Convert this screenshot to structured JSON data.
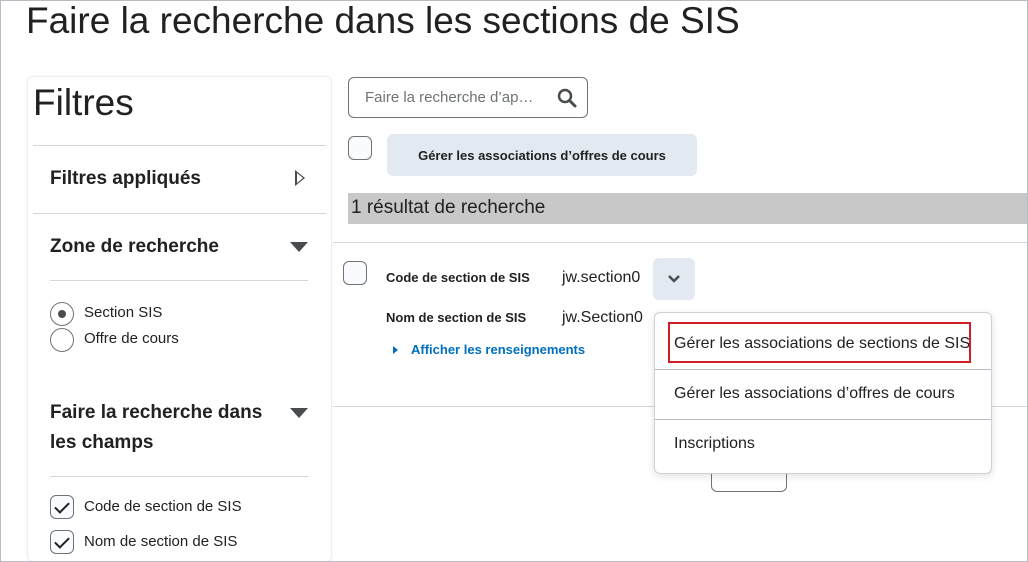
{
  "page_title": "Faire la recherche dans les sections de SIS",
  "filters": {
    "title": "Filtres",
    "applied": "Filtres appliqués",
    "zone": {
      "title": "Zone de recherche",
      "options": [
        {
          "label": "Section SIS",
          "selected": true
        },
        {
          "label": "Offre de cours",
          "selected": false
        }
      ]
    },
    "fields": {
      "title_line1": "Faire la recherche dans",
      "title_line2": "les champs",
      "options": [
        {
          "label": "Code de section de SIS",
          "checked": true
        },
        {
          "label": "Nom de section de SIS",
          "checked": true
        }
      ]
    }
  },
  "search": {
    "placeholder": "Faire la recherche d’ap…"
  },
  "bulk_button": "Gérer les associations d’offres de cours",
  "result_count": "1 résultat de recherche",
  "result": {
    "code_label": "Code de section de SIS",
    "code_value": "jw.section0",
    "name_label": "Nom de section de SIS",
    "name_value": "jw.Section0",
    "details_link": "Afficher les renseignements"
  },
  "menu": {
    "items": [
      "Gérer les associations de sections de SIS",
      "Gérer les associations d’offres de cours",
      "Inscriptions"
    ],
    "highlight_color": "#cd2026"
  }
}
